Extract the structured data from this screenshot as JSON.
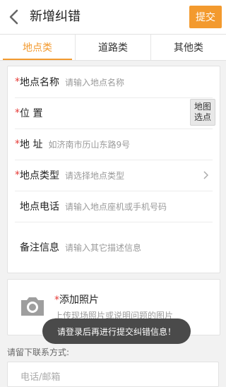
{
  "header": {
    "title": "新增纠错",
    "submit_label": "提交"
  },
  "tabs": [
    {
      "label": "地点类",
      "active": true
    },
    {
      "label": "道路类",
      "active": false
    },
    {
      "label": "其他类",
      "active": false
    }
  ],
  "form": {
    "place_name": {
      "required": "*",
      "label": "地点名称",
      "placeholder": "请输入地点名称"
    },
    "position": {
      "required": "*",
      "label": "位 置",
      "map_button_line1": "地图",
      "map_button_line2": "选点"
    },
    "address": {
      "required": "*",
      "label": "地 址",
      "placeholder": "如济南市历山东路9号"
    },
    "place_type": {
      "required": "*",
      "label": "地点类型",
      "placeholder": "请选择地点类型"
    },
    "phone": {
      "label": "地点电话",
      "placeholder": "请输入地点座机或手机号码"
    },
    "notes": {
      "label": "备注信息",
      "placeholder": "请输入其它描述信息"
    }
  },
  "photo": {
    "required": "*",
    "title": "添加照片",
    "subtitle": "上传现场照片或说明问题的图片"
  },
  "toast": "请登录后再进行提交纠错信息！",
  "contact": {
    "label": "请留下联系方式:",
    "placeholder": "电话/邮箱"
  },
  "colors": {
    "accent": "#f39a2e",
    "required": "#e53935"
  }
}
